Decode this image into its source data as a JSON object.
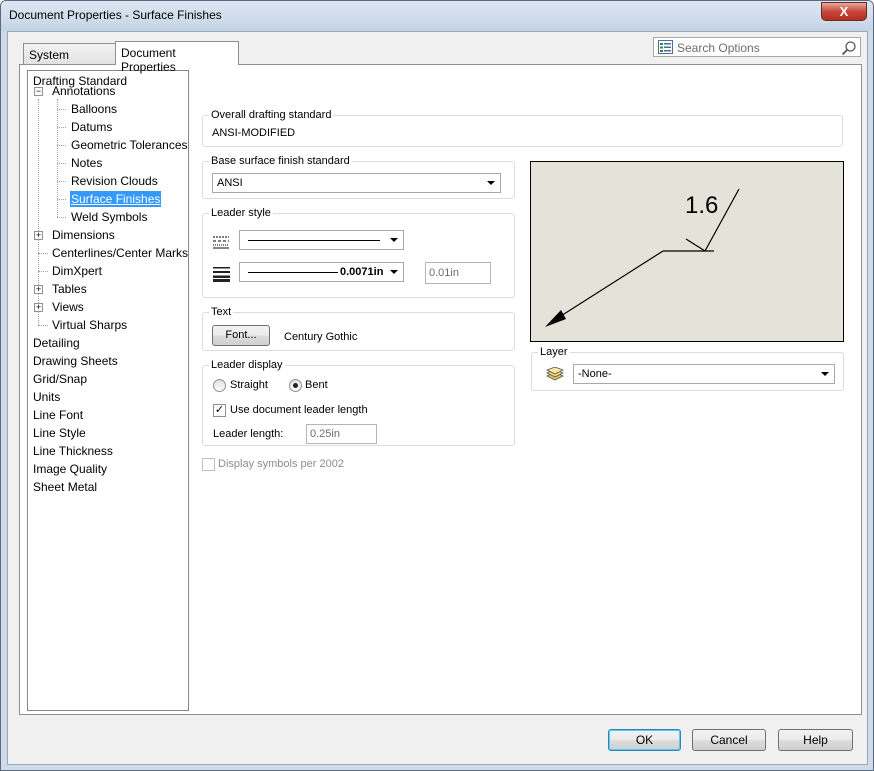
{
  "window": {
    "title": "Document Properties - Surface Finishes",
    "close_glyph": "X"
  },
  "tabs": [
    {
      "label": "System Options"
    },
    {
      "label": "Document Properties"
    }
  ],
  "search": {
    "placeholder": "Search Options"
  },
  "tree": {
    "items": [
      {
        "label": "Drafting Standard"
      },
      {
        "label": "Annotations",
        "expander": "−"
      },
      {
        "label": "Balloons"
      },
      {
        "label": "Datums"
      },
      {
        "label": "Geometric Tolerances"
      },
      {
        "label": "Notes"
      },
      {
        "label": "Revision Clouds"
      },
      {
        "label": "Surface Finishes",
        "selected": true
      },
      {
        "label": "Weld Symbols"
      },
      {
        "label": "Dimensions",
        "expander": "+"
      },
      {
        "label": "Centerlines/Center Marks"
      },
      {
        "label": "DimXpert"
      },
      {
        "label": "Tables",
        "expander": "+"
      },
      {
        "label": "Views",
        "expander": "+"
      },
      {
        "label": "Virtual Sharps"
      },
      {
        "label": "Detailing"
      },
      {
        "label": "Drawing Sheets"
      },
      {
        "label": "Grid/Snap"
      },
      {
        "label": "Units"
      },
      {
        "label": "Line Font"
      },
      {
        "label": "Line Style"
      },
      {
        "label": "Line Thickness"
      },
      {
        "label": "Image Quality"
      },
      {
        "label": "Sheet Metal"
      }
    ]
  },
  "overall": {
    "caption": "Overall drafting standard",
    "value": "ANSI-MODIFIED"
  },
  "base_standard": {
    "caption": "Base surface finish standard",
    "selected": "ANSI"
  },
  "leader_style": {
    "caption": "Leader style",
    "thickness_value": "0.0071in",
    "custom_value": "0.01in"
  },
  "text": {
    "caption": "Text",
    "font_button": "Font...",
    "font_name": "Century Gothic"
  },
  "leader_display": {
    "caption": "Leader display",
    "straight_label": "Straight",
    "bent_label": "Bent",
    "selected": "Bent",
    "use_doc_length_label": "Use document leader length",
    "use_doc_length_checked": true,
    "length_label": "Leader length:",
    "length_value": "0.25in"
  },
  "display_2002": {
    "label": "Display symbols per 2002",
    "checked": false,
    "enabled": false
  },
  "preview": {
    "symbol_value": "1.6"
  },
  "layer": {
    "caption": "Layer",
    "selected": "-None-"
  },
  "buttons": {
    "ok": "OK",
    "cancel": "Cancel",
    "help": "Help"
  }
}
